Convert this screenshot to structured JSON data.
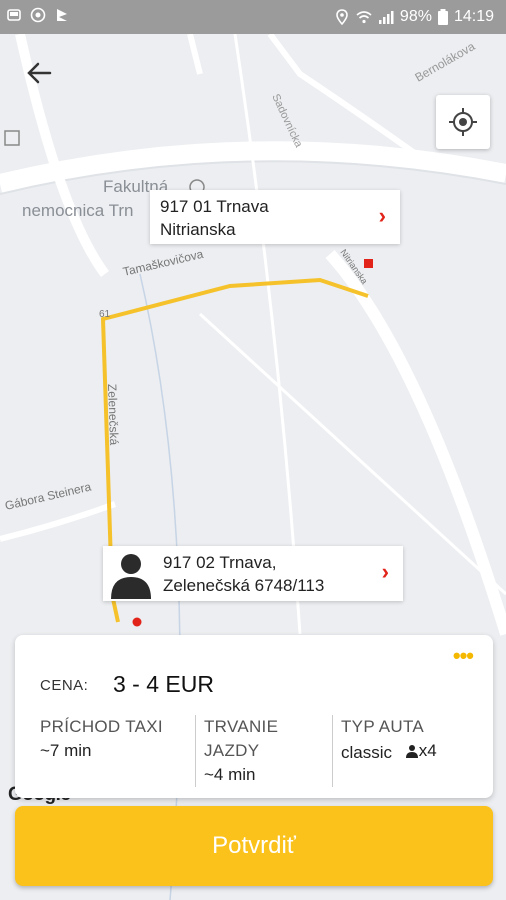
{
  "status_bar": {
    "battery": "98%",
    "time": "14:19",
    "left_icons": [
      "taxi-icon",
      "emoji-icon",
      "flag-icon"
    ],
    "right_icons": [
      "location-icon",
      "wifi-icon",
      "signal-icon",
      "battery-icon"
    ]
  },
  "map": {
    "streets": [
      "Sadovnícka",
      "Bernolákova",
      "Fakultná",
      "nemocnica Trn",
      "Tamaškovičova",
      "Nitrianska",
      "Zelenečská",
      "Gábora Steinera",
      "61"
    ],
    "attribution": "Google",
    "route_color": "#f5c22b",
    "pickup_color": "#e2231a"
  },
  "destination": {
    "line1": "917 01 Trnava",
    "line2": "Nitrianska"
  },
  "pickup": {
    "line1": "917 02 Trnava,",
    "line2": "Zelenečská 6748/113"
  },
  "summary": {
    "price_label": "CENA:",
    "price_value": "3 - 4 EUR",
    "arrival_label": "PRÍCHOD TAXI",
    "arrival_value": "~7 min",
    "duration_label1": "TRVANIE",
    "duration_label2": "JAZDY",
    "duration_value": "~4 min",
    "cartype_label": "TYP AUTA",
    "cartype_value": "classic",
    "seats": "x4"
  },
  "confirm_label": "Potvrdiť",
  "accent": "#fbc21b"
}
